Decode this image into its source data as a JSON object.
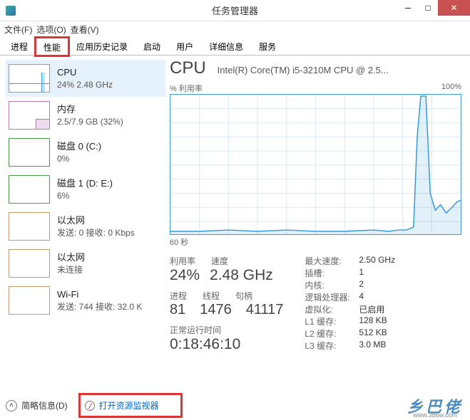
{
  "window": {
    "title": "任务管理器"
  },
  "menu": {
    "file": "文件(F)",
    "options": "选项(O)",
    "view": "查看(V)"
  },
  "tabs": [
    "进程",
    "性能",
    "应用历史记录",
    "启动",
    "用户",
    "详细信息",
    "服务"
  ],
  "sidebar": {
    "items": [
      {
        "title": "CPU",
        "sub": "24% 2.48 GHz"
      },
      {
        "title": "内存",
        "sub": "2.5/7.9 GB (32%)"
      },
      {
        "title": "磁盘 0 (C:)",
        "sub": "0%"
      },
      {
        "title": "磁盘 1 (D: E:)",
        "sub": "6%"
      },
      {
        "title": "以太网",
        "sub": "发送: 0 接收: 0 Kbps"
      },
      {
        "title": "以太网",
        "sub": "未连接"
      },
      {
        "title": "Wi-Fi",
        "sub": "发送: 744 接收: 32.0 K"
      }
    ]
  },
  "main": {
    "title": "CPU",
    "subtitle": "Intel(R) Core(TM) i5-3210M CPU @ 2.5...",
    "chart_label_left": "% 利用率",
    "chart_label_right": "100%",
    "chart_label_bottom": "60 秒",
    "labels1": {
      "util": "利用率",
      "speed": "速度"
    },
    "values1": {
      "util": "24%",
      "speed": "2.48 GHz"
    },
    "labels2": {
      "proc": "进程",
      "threads": "线程",
      "handles": "句柄"
    },
    "values2": {
      "proc": "81",
      "threads": "1476",
      "handles": "41117"
    },
    "uptime_label": "正常运行时间",
    "uptime": "0:18:46:10",
    "specs": {
      "max_speed_k": "最大速度:",
      "max_speed_v": "2.50 GHz",
      "sockets_k": "插槽:",
      "sockets_v": "1",
      "cores_k": "内核:",
      "cores_v": "2",
      "logical_k": "逻辑处理器:",
      "logical_v": "4",
      "virt_k": "虚拟化:",
      "virt_v": "已启用",
      "l1_k": "L1 缓存:",
      "l1_v": "128 KB",
      "l2_k": "L2 缓存:",
      "l2_v": "512 KB",
      "l3_k": "L3 缓存:",
      "l3_v": "3.0 MB"
    }
  },
  "footer": {
    "collapse": "简略信息(D)",
    "link": "打开资源监视器"
  },
  "chart_data": {
    "type": "line",
    "title": "% 利用率",
    "xlabel": "60 秒",
    "ylabel": "% 利用率",
    "ylim": [
      0,
      100
    ],
    "xlim_seconds": [
      60,
      0
    ],
    "series": [
      {
        "name": "CPU %",
        "x_seconds_ago": [
          60,
          55,
          50,
          45,
          40,
          35,
          30,
          25,
          20,
          15,
          12,
          10,
          9,
          8,
          7,
          6,
          5,
          4,
          3,
          2,
          1,
          0
        ],
        "values": [
          2,
          2,
          3,
          2,
          3,
          2,
          2,
          3,
          2,
          2,
          3,
          3,
          5,
          70,
          100,
          100,
          30,
          18,
          22,
          16,
          20,
          24
        ]
      }
    ]
  }
}
